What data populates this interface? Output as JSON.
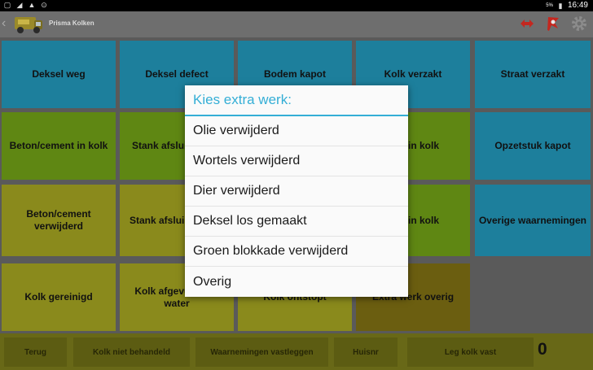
{
  "statusbar": {
    "battery": "5%",
    "time": "16:49"
  },
  "app": {
    "title": "Prisma Kolken"
  },
  "tiles": {
    "deksel_weg": "Deksel weg",
    "deksel_defect": "Deksel defect",
    "bodem_kapot": "Bodem kapot",
    "kolk_verzakt": "Kolk verzakt",
    "straat_verzakt": "Straat verzakt",
    "beton_in_kolk": "Beton/cement in kolk",
    "stank_afsluiter_1": "Stank afslui",
    "in_kolk_1": "in kolk",
    "opzetstuk_kapot": "Opzetstuk kapot",
    "beton_verwijderd": "Beton/cement verwijderd",
    "stank_afsluiter_2": "Stank afslui",
    "in_kolk_2": "in kolk",
    "overige_waarnemingen": "Overige waarnemingen",
    "kolk_gereinigd": "Kolk gereinigd",
    "kolk_afgevuld": "Kolk afgevuld met water",
    "kolk_ontstopt": "Kolk ontstopt",
    "extra_werk_overig": "Extra werk overig"
  },
  "bottombar": {
    "terug": "Terug",
    "niet_behandeld": "Kolk niet behandeld",
    "waarnemingen": "Waarnemingen vastleggen",
    "huisnr": "Huisnr",
    "leg_kolk_vast": "Leg kolk vast",
    "count": "0"
  },
  "dialog": {
    "title": "Kies extra werk:",
    "items": [
      "Olie verwijderd",
      "Wortels verwijderd",
      "Dier verwijderd",
      "Deksel los gemaakt",
      "Groen blokkade verwijderd",
      "Overig"
    ]
  },
  "colors": {
    "accent": "#34aed6",
    "tile_blue": "#1d7f9c",
    "tile_green": "#5f8713",
    "tile_yellow": "#8a8a1c",
    "tile_olive": "#6b5e10"
  },
  "icons": [
    "wifi-icon",
    "warning-icon",
    "sync-icon",
    "battery-icon",
    "van-logo-icon",
    "swap-arrows-icon",
    "flag-icon",
    "gear-icon"
  ]
}
